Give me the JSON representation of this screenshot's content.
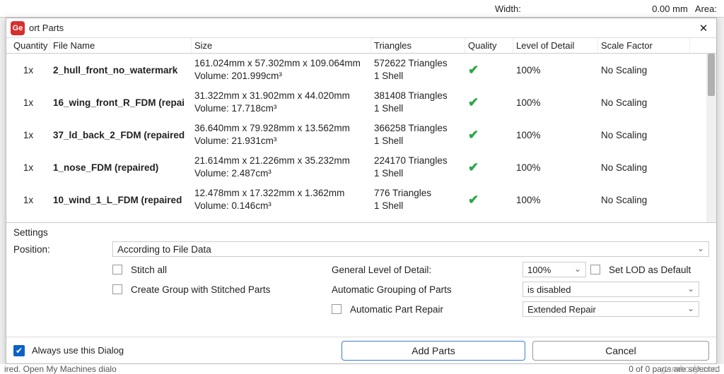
{
  "bg": {
    "width_label": "Width:",
    "width_value": "0.00 mm",
    "area_label": "Area:"
  },
  "dialog_title": "ort Parts",
  "logo_text": "Ge",
  "columns": {
    "qty": "Quantity",
    "file": "File Name",
    "size": "Size",
    "tri": "Triangles",
    "qual": "Quality",
    "lod": "Level of Detail",
    "scale": "Scale Factor"
  },
  "rows": [
    {
      "qty": "1x",
      "file": "2_hull_front_no_watermark",
      "size_line1": "161.024mm x 57.302mm x 109.064mm",
      "size_line2": "Volume: 201.999cm³",
      "tri_line1": "572622 Triangles",
      "tri_line2": "1 Shell",
      "lod": "100%",
      "scale": "No Scaling"
    },
    {
      "qty": "1x",
      "file": "16_wing_front_R_FDM (repai",
      "size_line1": "31.322mm x 31.902mm x 44.020mm",
      "size_line2": "Volume: 17.718cm³",
      "tri_line1": "381408 Triangles",
      "tri_line2": "1 Shell",
      "lod": "100%",
      "scale": "No Scaling"
    },
    {
      "qty": "1x",
      "file": "37_ld_back_2_FDM (repaired",
      "size_line1": "36.640mm x 79.928mm x 13.562mm",
      "size_line2": "Volume: 21.931cm³",
      "tri_line1": "366258 Triangles",
      "tri_line2": "1 Shell",
      "lod": "100%",
      "scale": "No Scaling"
    },
    {
      "qty": "1x",
      "file": "1_nose_FDM (repaired)",
      "size_line1": "21.614mm x 21.226mm x 35.232mm",
      "size_line2": "Volume: 2.487cm³",
      "tri_line1": "224170 Triangles",
      "tri_line2": "1 Shell",
      "lod": "100%",
      "scale": "No Scaling"
    },
    {
      "qty": "1x",
      "file": "10_wind_1_L_FDM (repaired",
      "size_line1": "12.478mm x 17.322mm x 1.362mm",
      "size_line2": "Volume: 0.146cm³",
      "tri_line1": "776 Triangles",
      "tri_line2": "1 Shell",
      "lod": "100%",
      "scale": "No Scaling"
    }
  ],
  "settings": {
    "heading": "Settings",
    "position_label": "Position:",
    "position_value": "According to File Data",
    "stitch_all": "Stitch all",
    "create_group": "Create Group with Stitched Parts",
    "general_lod_label": "General Level of Detail:",
    "general_lod_value": "100%",
    "set_lod_default": "Set LOD as Default",
    "auto_group_label": "Automatic Grouping of Parts",
    "auto_group_value": "is disabled",
    "auto_repair_label": "Automatic Part Repair",
    "auto_repair_value": "Extended Repair"
  },
  "buttons": {
    "always": "Always use this Dialog",
    "add": "Add Parts",
    "cancel": "Cancel"
  },
  "footer": {
    "left": "ired. Open My Machines dialo",
    "right": "0 of 0 parts are selected"
  },
  "watermark": "gambody.com",
  "check_mark": "✔"
}
